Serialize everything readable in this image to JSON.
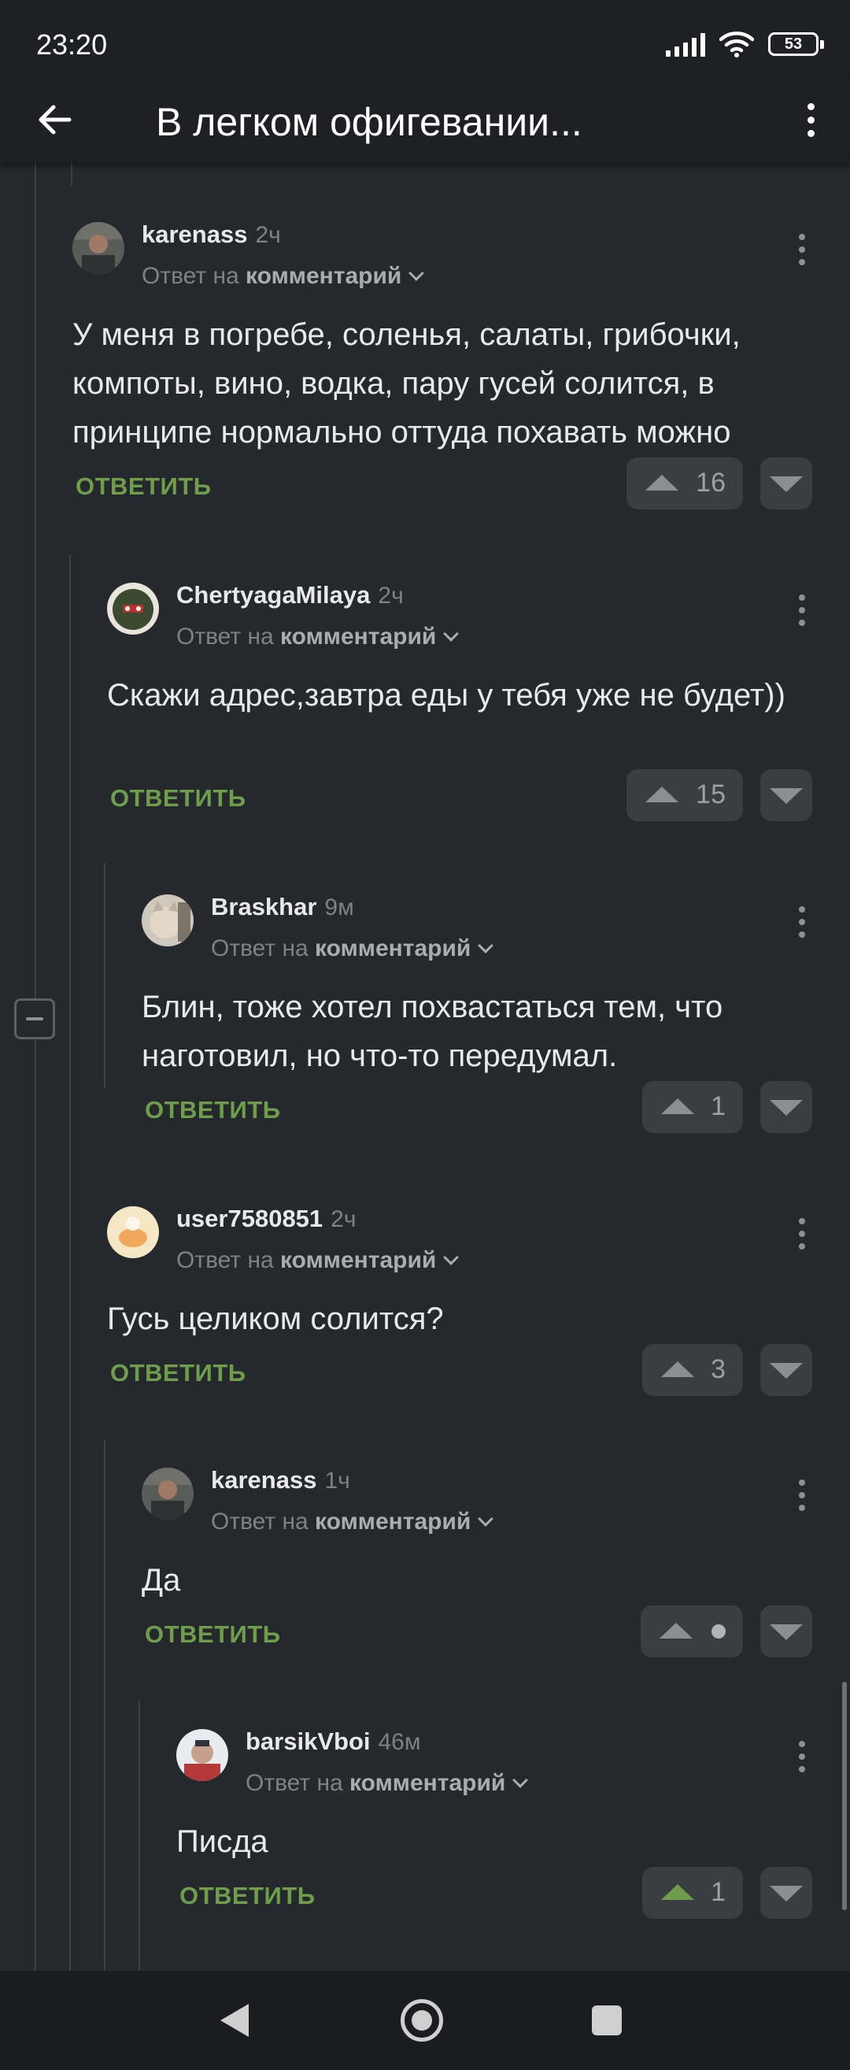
{
  "status_bar": {
    "time": "23:20",
    "battery": "53"
  },
  "app_bar": {
    "title": "В легком офигевании..."
  },
  "comments": [
    {
      "username": "karenass",
      "age": "2ч",
      "reply_prefix": "Ответ на",
      "reply_target": "комментарий",
      "text": "У меня в погребе, соленья, салаты, грибочки, компоты, вино, водка, пару гусей солится, в принципе нормально оттуда похавать можно",
      "reply_label": "ОТВЕТИТЬ",
      "votes": "16"
    },
    {
      "username": "ChertyagaMilaya",
      "age": "2ч",
      "reply_prefix": "Ответ на",
      "reply_target": "комментарий",
      "text": "Скажи адрес,завтра еды у тебя уже не будет))",
      "reply_label": "ОТВЕТИТЬ",
      "votes": "15"
    },
    {
      "username": "Braskhar",
      "age": "9м",
      "reply_prefix": "Ответ на",
      "reply_target": "комментарий",
      "text": "Блин, тоже хотел похвастаться тем, что наготовил, но что-то передумал.",
      "reply_label": "ОТВЕТИТЬ",
      "votes": "1"
    },
    {
      "username": "user7580851",
      "age": "2ч",
      "reply_prefix": "Ответ на",
      "reply_target": "комментарий",
      "text": "Гусь целиком солится?",
      "reply_label": "ОТВЕТИТЬ",
      "votes": "3"
    },
    {
      "username": "karenass",
      "age": "1ч",
      "reply_prefix": "Ответ на",
      "reply_target": "комментарий",
      "text": "Да",
      "reply_label": "ОТВЕТИТЬ",
      "votes": ""
    },
    {
      "username": "barsikVboi",
      "age": "46м",
      "reply_prefix": "Ответ на",
      "reply_target": "комментарий",
      "text": "Писда",
      "reply_label": "ОТВЕТИТЬ",
      "votes": "1"
    }
  ],
  "colors": {
    "accent_green": "#6f9e4b",
    "background": "#25282c",
    "bar": "#1e2023"
  }
}
